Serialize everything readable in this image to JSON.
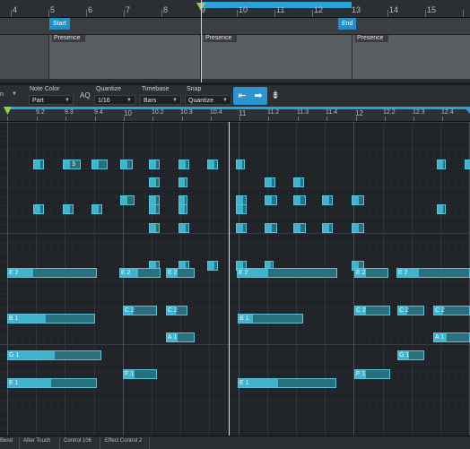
{
  "arrangement": {
    "ruler_numbers": [
      "4",
      "5",
      "6",
      "7",
      "8",
      "9",
      "10",
      "11",
      "12",
      "13",
      "14",
      "15"
    ],
    "loop_start_label": "Start",
    "loop_end_label": "End",
    "event_label": "Presence"
  },
  "toolbar": {
    "partial_label": "n",
    "note_color_label": "Note Color",
    "note_color_value": "Part",
    "aq_label": "AQ",
    "quantize_label": "Quantize",
    "quantize_value": "1/16",
    "timebase_label": "Timebase",
    "timebase_value": "Bars",
    "snap_label": "Snap",
    "snap_value": "Quantize"
  },
  "editor_ruler": [
    "9.2",
    "9.3",
    "9.4",
    "10",
    "10.2",
    "10.3",
    "10.4",
    "11",
    "11.2",
    "11.3",
    "11.4",
    "12",
    "12.2",
    "12.3",
    "12.4"
  ],
  "notes": [
    {
      "label": "E 2"
    },
    {
      "label": "E 2"
    },
    {
      "label": "E 2"
    },
    {
      "label": "E 2"
    },
    {
      "label": "E 2"
    },
    {
      "label": "E 2"
    },
    {
      "label": "C 2"
    },
    {
      "label": "C 2"
    },
    {
      "label": "C 2"
    },
    {
      "label": "C 2"
    },
    {
      "label": "C 2"
    },
    {
      "label": "B 1"
    },
    {
      "label": "B 1"
    },
    {
      "label": "A 1"
    },
    {
      "label": "A 1"
    },
    {
      "label": "G 1"
    },
    {
      "label": "G 1"
    },
    {
      "label": "F 1"
    },
    {
      "label": "F 1"
    },
    {
      "label": "E 1"
    },
    {
      "label": "E 1"
    },
    {
      "label": "3"
    }
  ],
  "lanes": {
    "pitch_bend": "Bend",
    "after_touch": "After Touch",
    "control_106": "Control 106",
    "effect_control_2": "Effect Control 2"
  },
  "colors": {
    "accent": "#2aa2d8",
    "note_fill": "#2a6f7e",
    "note_border": "#56c5db",
    "background": "#202327"
  }
}
